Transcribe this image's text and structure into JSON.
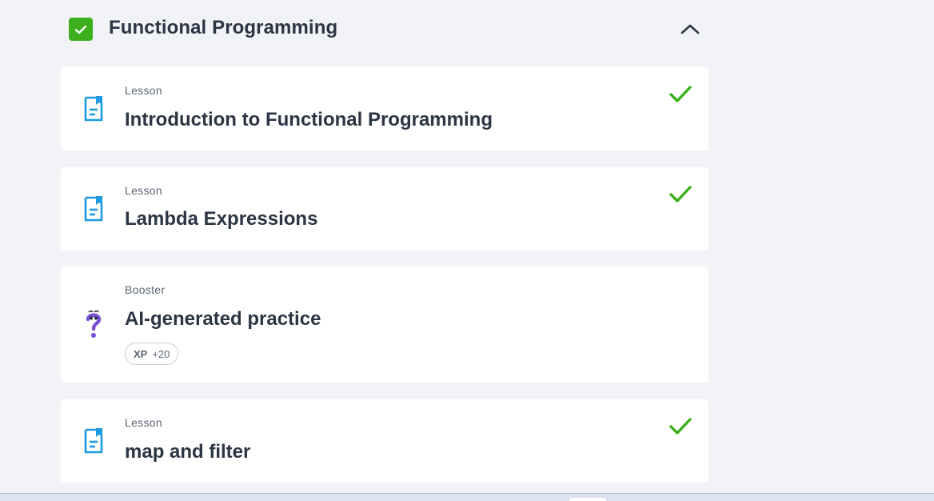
{
  "section": {
    "title": "Functional Programming",
    "completed": true,
    "expanded": true
  },
  "items": [
    {
      "kind": "Lesson",
      "title": "Introduction to Functional Programming",
      "icon": "lesson-document-icon",
      "completed": true
    },
    {
      "kind": "Lesson",
      "title": "Lambda Expressions",
      "icon": "lesson-document-icon",
      "completed": true
    },
    {
      "kind": "Booster",
      "title": "AI-generated practice",
      "icon": "question-mark-icon",
      "completed": false,
      "xp_label": "XP",
      "xp_value": "+20"
    },
    {
      "kind": "Lesson",
      "title": "map and filter",
      "icon": "lesson-document-icon",
      "completed": true
    }
  ],
  "colors": {
    "accent_green": "#3bb01c",
    "lesson_icon_blue": "#1e9be0",
    "booster_icon_purple": "#7a4fd6",
    "background": "#f1f3f6",
    "card": "#ffffff"
  }
}
